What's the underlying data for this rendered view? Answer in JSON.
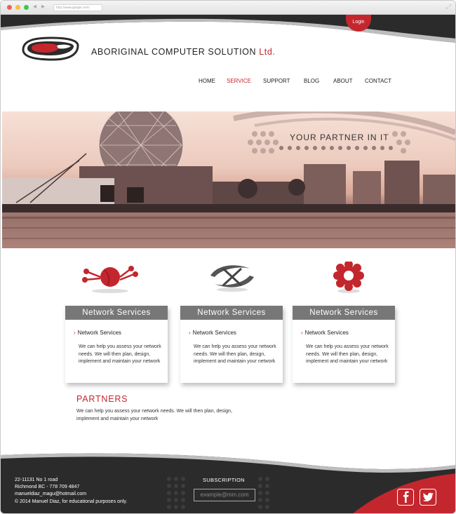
{
  "browser": {
    "url": "http://www.google.com/"
  },
  "header": {
    "login_label": "Login",
    "brand_name": "ABORIGINAL COMPUTER SOLUTION",
    "brand_suffix": "Ltd."
  },
  "nav": {
    "items": [
      {
        "label": "HOME"
      },
      {
        "label": "SERVICE"
      },
      {
        "label": "SUPPORT"
      },
      {
        "label": "BLOG"
      },
      {
        "label": "ABOUT"
      },
      {
        "label": "CONTACT"
      }
    ],
    "active": "SERVICE"
  },
  "hero": {
    "tagline": "YOUR PARTNER IN IT"
  },
  "services": [
    {
      "title": "Network Services",
      "subtitle": "Network Services",
      "text": "We can help you assess your network needs. We will then plan, design, implement and maintain your network"
    },
    {
      "title": "Network Services",
      "subtitle": "Network Services",
      "text": "We can help you assess your network needs. We will then plan, design, implement and maintain your network"
    },
    {
      "title": "Network Services",
      "subtitle": "Network Services",
      "text": "We can help you assess your network needs. We will then plan, design, implement and maintain your network"
    }
  ],
  "partners": {
    "title": "PARTNERS",
    "text": "We can help you assess your network needs. We will then plan, design, implement and maintain your network"
  },
  "footer": {
    "address_line1": "22-11131 No 1 road",
    "address_line2": "Richmond BC - 778 709 4847",
    "email": "manueldiaz_magu@hotmail.com",
    "copyright": "© 2014 Manuel Diaz, for educational purposes only.",
    "subscription_title": "SUBSCRIPTION",
    "subscription_placeholder": "example@mm.com"
  },
  "colors": {
    "accent": "#c4262e",
    "dark": "#2b2b2b",
    "box_header": "#777777"
  }
}
